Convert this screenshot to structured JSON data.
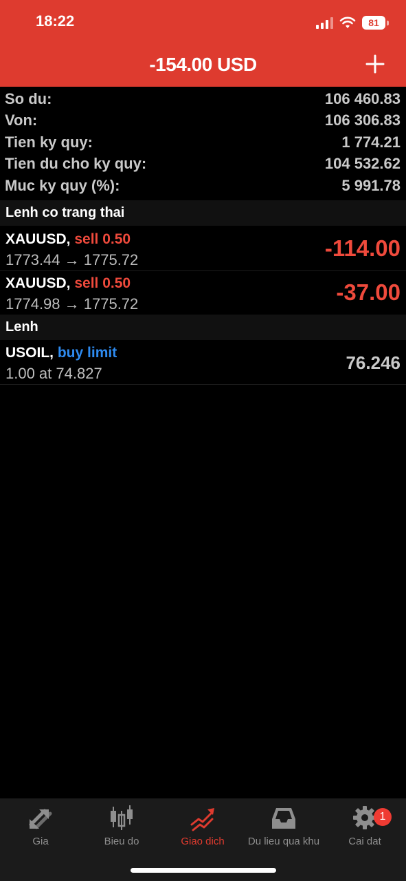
{
  "status": {
    "time": "18:22",
    "battery": "81"
  },
  "header": {
    "title": "-154.00 USD"
  },
  "summary": [
    {
      "label": "So du:",
      "value": "106 460.83"
    },
    {
      "label": "Von:",
      "value": "106 306.83"
    },
    {
      "label": "Tien ky quy:",
      "value": "1 774.21"
    },
    {
      "label": "Tien du cho ky quy:",
      "value": "104 532.62"
    },
    {
      "label": "Muc ky quy (%):",
      "value": "5 991.78"
    }
  ],
  "positions_header": "Lenh co trang thai",
  "positions": [
    {
      "symbol": "XAUUSD,",
      "side": "sell 0.50",
      "prices": "1773.44 → 1775.72",
      "profit": "-114.00"
    },
    {
      "symbol": "XAUUSD,",
      "side": "sell 0.50",
      "prices": "1774.98 → 1775.72",
      "profit": "-37.00"
    }
  ],
  "orders_header": "Lenh",
  "orders": [
    {
      "symbol": "USOIL,",
      "side": "buy limit",
      "details": "1.00 at 74.827",
      "price": "76.246"
    }
  ],
  "tabs": [
    {
      "label": "Gia",
      "icon": "quotes-arrows-icon"
    },
    {
      "label": "Bieu do",
      "icon": "candlestick-chart-icon"
    },
    {
      "label": "Giao dich",
      "icon": "trade-chart-icon"
    },
    {
      "label": "Du lieu qua khu",
      "icon": "history-inbox-icon"
    },
    {
      "label": "Cai dat",
      "icon": "gear-icon",
      "badge": "1"
    }
  ],
  "colors": {
    "accent": "#de3b2f",
    "loss": "#ef4a3c",
    "buy": "#2e8bf0"
  }
}
